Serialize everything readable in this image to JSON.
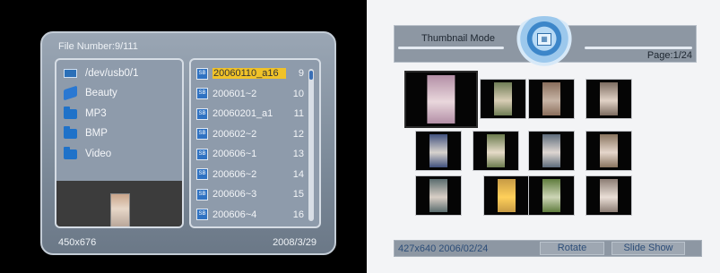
{
  "browser": {
    "file_number": "File Number:9/111",
    "folders": [
      {
        "label": "/dev/usb0/1",
        "icon": "usb-drive-icon"
      },
      {
        "label": "Beauty",
        "icon": "folder-open-icon"
      },
      {
        "label": "MP3",
        "icon": "folder-icon"
      },
      {
        "label": "BMP",
        "icon": "folder-icon"
      },
      {
        "label": "Video",
        "icon": "folder-icon"
      }
    ],
    "files": [
      {
        "name": "20060110_a16",
        "num": "9",
        "selected": true
      },
      {
        "name": "200601~2",
        "num": "10"
      },
      {
        "name": "20060201_a1",
        "num": "11"
      },
      {
        "name": "200602~2",
        "num": "12"
      },
      {
        "name": "200606~1",
        "num": "13"
      },
      {
        "name": "200606~2",
        "num": "14"
      },
      {
        "name": "200606~3",
        "num": "15"
      },
      {
        "name": "200606~4",
        "num": "16"
      }
    ],
    "resolution": "450x676",
    "date": "2008/3/29"
  },
  "thumbnails": {
    "mode_label": "Thumbnail Mode",
    "page_label": "Page:1/24",
    "status_text": "427x640  2006/02/24",
    "rotate_label": "Rotate",
    "slideshow_label": "Slide Show",
    "photos": [
      {
        "colors": [
          "#b38fa6",
          "#e9d7dc"
        ]
      },
      {
        "colors": [
          "#6f7d55",
          "#d8cdb5"
        ]
      },
      {
        "colors": [
          "#8a6e5c",
          "#c7b4a5"
        ]
      },
      {
        "colors": [
          "#7d6c60",
          "#e1d2c6"
        ]
      },
      {
        "colors": [
          "#41517e",
          "#d7d2cd"
        ]
      },
      {
        "colors": [
          "#6b7b4e",
          "#e6dbc8"
        ]
      },
      {
        "colors": [
          "#5d6b7b",
          "#ded6d1"
        ]
      },
      {
        "colors": [
          "#89745f",
          "#e5d6cb"
        ]
      },
      {
        "colors": [
          "#5a6c6e",
          "#d9cfc6"
        ]
      },
      {
        "colors": [
          "#c79b45",
          "#ffd05a"
        ]
      },
      {
        "colors": [
          "#5f7c3d",
          "#cdd5b6"
        ]
      },
      {
        "colors": [
          "#8c7d74",
          "#eadfd7"
        ]
      }
    ]
  }
}
